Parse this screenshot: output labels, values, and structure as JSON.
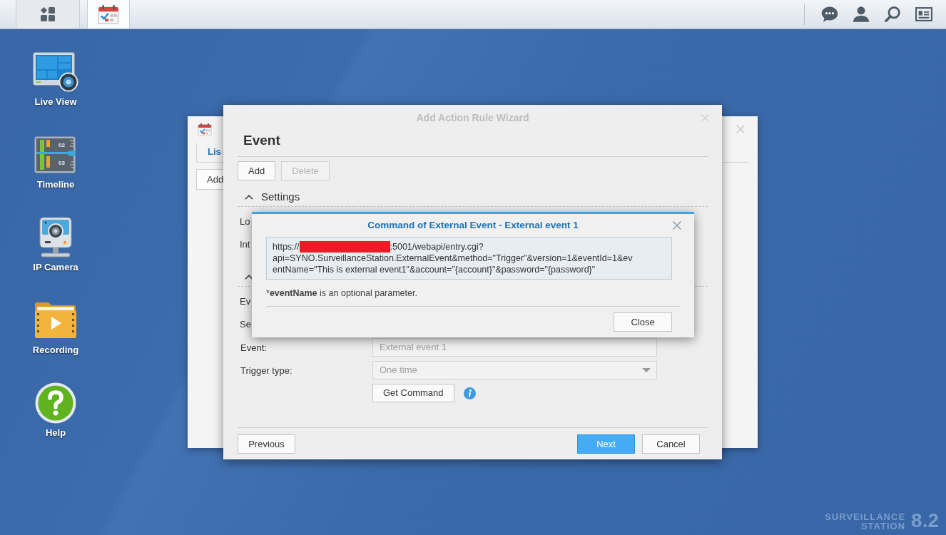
{
  "taskbar": {
    "open_apps": [
      {
        "selected": true
      }
    ]
  },
  "desktop_shortcuts": [
    {
      "kind": "live-view",
      "label": "Live View"
    },
    {
      "kind": "timeline",
      "label": "Timeline",
      "icon_text": [
        "02",
        "03"
      ]
    },
    {
      "kind": "ip-camera",
      "label": "IP Camera"
    },
    {
      "kind": "recording",
      "label": "Recording"
    },
    {
      "kind": "help",
      "label": "Help"
    }
  ],
  "background_window": {
    "tabs": [
      {
        "label": "Lis",
        "selected": true
      }
    ],
    "toolbar_buttons": [
      "Add"
    ]
  },
  "wizard": {
    "title": "Add Action Rule Wizard",
    "active": false,
    "heading": "Event",
    "toolbar": [
      {
        "label": "Add",
        "disabled": false
      },
      {
        "label": "Delete",
        "disabled": true
      }
    ],
    "sections": [
      {
        "title": "Settings",
        "expanded": true,
        "rows": [
          {
            "kind": "label",
            "label": "Lo"
          },
          {
            "kind": "label",
            "label": "Int"
          }
        ]
      },
      {
        "expanded": true,
        "rows": [
          {
            "kind": "label",
            "label": "Ev"
          },
          {
            "kind": "label",
            "label": "Se"
          },
          {
            "kind": "text",
            "label": "Event:",
            "value": "External event 1",
            "disabled": true
          },
          {
            "kind": "select",
            "label": "Trigger type:",
            "value": "One time",
            "disabled": true
          },
          {
            "kind": "button",
            "label": "Get Command",
            "info": true
          }
        ]
      }
    ],
    "footer": {
      "left": [
        {
          "label": "Previous",
          "primary": false
        }
      ],
      "right": [
        {
          "label": "Next",
          "primary": true
        },
        {
          "label": "Cancel",
          "primary": false
        }
      ]
    }
  },
  "command_dialog": {
    "title": "Command of External Event - External event 1",
    "command": {
      "prefix": "https://",
      "host_redacted": true,
      "lines": [
        ":5001/webapi/entry.cgi?",
        "api=SYNO.SurveillanceStation.ExternalEvent&method=\"Trigger\"&version=1&eventId=1&ev",
        "entName=\"This is external event1\"&account=\"{account}\"&password=\"{password}\""
      ]
    },
    "note": {
      "mark": "*",
      "text": "**eventName** is an optional parameter."
    },
    "buttons": [
      "Close"
    ]
  },
  "wallpaper_logo": {
    "line_1": "SURVEILLANCE",
    "line_2": "STATION",
    "version": "8.2"
  }
}
